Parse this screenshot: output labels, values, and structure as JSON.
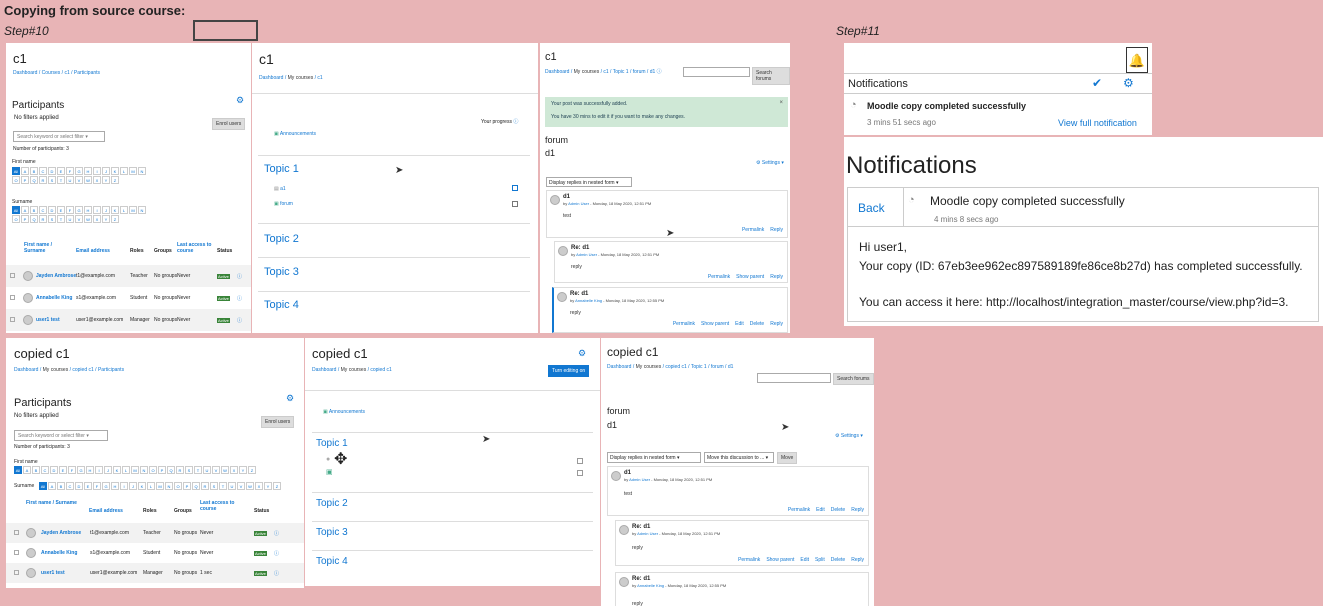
{
  "annotation": {
    "heading": "Copying from source course:",
    "step10": "Step#10",
    "step11": "Step#11"
  },
  "p1": {
    "title": "c1",
    "crumbs": [
      "Dashboard",
      "Courses",
      "c1",
      "Participants"
    ],
    "section": "Participants",
    "filters": "No filters applied",
    "search_placeholder": "Search keyword or select filter",
    "enrol": "Enrol users",
    "count": "Number of participants: 3",
    "first_name": "First name",
    "surname": "Surname",
    "letters": [
      "All",
      "A",
      "B",
      "C",
      "D",
      "E",
      "F",
      "G",
      "H",
      "I",
      "J",
      "K",
      "L",
      "M",
      "N",
      "O",
      "P",
      "Q",
      "R",
      "S",
      "T",
      "U",
      "V",
      "W",
      "X",
      "Y",
      "Z"
    ],
    "cols": [
      "First name / Surname",
      "Email address",
      "Roles",
      "Groups",
      "Last access to course",
      "Status"
    ],
    "rows": [
      {
        "name": "Jayden Ambrose",
        "email": "t1@example.com",
        "role": "Teacher",
        "groups": "No groups",
        "access": "Never",
        "status": "Active"
      },
      {
        "name": "Annabelle King",
        "email": "s1@example.com",
        "role": "Student",
        "groups": "No groups",
        "access": "Never",
        "status": "Active"
      },
      {
        "name": "user1 test",
        "email": "user1@example.com",
        "role": "Manager",
        "groups": "No groups",
        "access": "Never",
        "status": "Active"
      }
    ]
  },
  "p2": {
    "title": "c1",
    "crumbs": [
      "Dashboard",
      "My courses",
      "c1"
    ],
    "progress": "Your progress",
    "announcements": "Announcements",
    "topics": [
      "Topic 1",
      "Topic 2",
      "Topic 3",
      "Topic 4"
    ],
    "activities": [
      "a1",
      "forum"
    ]
  },
  "p3": {
    "title": "c1",
    "crumbs": [
      "Dashboard",
      "My courses",
      "c1",
      "Topic 1",
      "forum",
      "d1"
    ],
    "search_btn": "Search forums",
    "alert1": "Your post was successfully added.",
    "alert2": "You have 30 mins to edit it if you want to make any changes.",
    "forum": "forum",
    "d1": "d1",
    "settings": "Settings",
    "display": "Display replies in nested form",
    "posts": [
      {
        "subject": "d1",
        "by": "by",
        "author": "Admin User",
        "date": " - Monday, 18 May 2020, 12:51 PM",
        "body": "test",
        "acts": [
          "Permalink",
          "Reply"
        ]
      },
      {
        "subject": "Re: d1",
        "by": "by",
        "author": "Admin User",
        "date": " - Monday, 18 May 2020, 12:51 PM",
        "body": "reply",
        "acts": [
          "Permalink",
          "Show parent",
          "Reply"
        ]
      },
      {
        "subject": "Re: d1",
        "by": "by",
        "author": "Annabelle King",
        "date": " - Monday, 18 May 2020, 12:55 PM",
        "body": "reply",
        "acts": [
          "Permalink",
          "Show parent",
          "Edit",
          "Delete",
          "Reply"
        ]
      }
    ]
  },
  "p4": {
    "header": "Notifications",
    "item": "Moodle copy completed successfully",
    "time": "3 mins 51 secs ago",
    "view": "View full notification"
  },
  "p5": {
    "title": "Notifications",
    "back": "Back",
    "item": "Moodle copy completed successfully",
    "time": "4 mins 8 secs ago",
    "hi": "Hi user1,",
    "line2": "Your copy (ID: 67eb3ee962ec897589189fe86ce8b27d) has completed successfully.",
    "line3": "You can access it here: http://localhost/integration_master/course/view.php?id=3."
  },
  "p6": {
    "title": "copied c1",
    "crumbs": [
      "Dashboard",
      "My courses",
      "copied c1",
      "Participants"
    ],
    "section": "Participants",
    "filters": "No filters applied",
    "search_placeholder": "Search keyword or select filter",
    "enrol": "Enrol users",
    "count": "Number of participants: 3",
    "first_name": "First name",
    "surname": "Surname",
    "cols": [
      "First name / Surname",
      "Email address",
      "Roles",
      "Groups",
      "Last access to course",
      "Status"
    ],
    "rows": [
      {
        "name": "Jayden Ambrose",
        "email": "t1@example.com",
        "role": "Teacher",
        "groups": "No groups",
        "access": "Never",
        "status": "Active"
      },
      {
        "name": "Annabelle King",
        "email": "s1@example.com",
        "role": "Student",
        "groups": "No groups",
        "access": "Never",
        "status": "Active"
      },
      {
        "name": "user1 test",
        "email": "user1@example.com",
        "role": "Manager",
        "groups": "No groups",
        "access": "1 sec",
        "status": "Active"
      }
    ]
  },
  "p7": {
    "title": "copied c1",
    "crumbs": [
      "Dashboard",
      "My courses",
      "copied c1"
    ],
    "turn_editing": "Turn editing on",
    "announcements": "Announcements",
    "topics": [
      "Topic 1",
      "Topic 2",
      "Topic 3",
      "Topic 4"
    ]
  },
  "p8": {
    "title": "copied c1",
    "crumbs": [
      "Dashboard",
      "My courses",
      "copied c1",
      "Topic 1",
      "forum",
      "d1"
    ],
    "search_btn": "Search forums",
    "forum": "forum",
    "d1": "d1",
    "settings": "Settings",
    "display": "Display replies in nested form",
    "move": "Move this discussion to ...",
    "move_btn": "Move",
    "posts": [
      {
        "subject": "d1",
        "by": "by",
        "author": "Admin User",
        "date": " - Monday, 18 May 2020, 12:51 PM",
        "body": "test",
        "acts": [
          "Permalink",
          "Edit",
          "Delete",
          "Reply"
        ]
      },
      {
        "subject": "Re: d1",
        "by": "by",
        "author": "Admin User",
        "date": " - Monday, 18 May 2020, 12:51 PM",
        "body": "reply",
        "acts": [
          "Permalink",
          "Show parent",
          "Edit",
          "Split",
          "Delete",
          "Reply"
        ]
      },
      {
        "subject": "Re: d1",
        "by": "by",
        "author": "Annabelle King",
        "date": " - Monday, 18 May 2020, 12:55 PM",
        "body": "reply",
        "acts": []
      }
    ]
  }
}
